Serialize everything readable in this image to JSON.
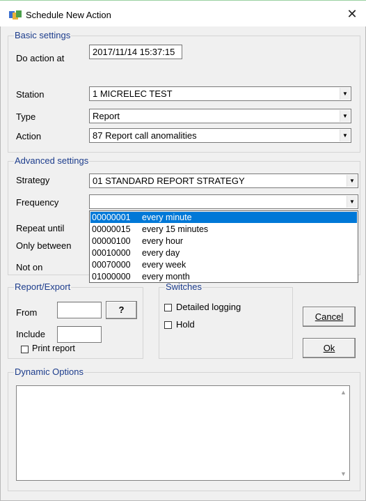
{
  "window": {
    "title": "Schedule New Action",
    "close_glyph": "✕"
  },
  "basic_settings": {
    "legend": "Basic settings",
    "do_action_at_label": "Do action at",
    "do_action_at_value": "2017/11/14 15:37:15",
    "station_label": "Station",
    "station_value": "1  MICRELEC TEST",
    "type_label": "Type",
    "type_value": "Report",
    "action_label": "Action",
    "action_value": "87  Report call anomalities"
  },
  "advanced_settings": {
    "legend": "Advanced settings",
    "strategy_label": "Strategy",
    "strategy_value": "01  STANDARD REPORT STRATEGY",
    "frequency_label": "Frequency",
    "frequency_value": "",
    "repeat_until_label": "Repeat until",
    "only_between_label": "Only between",
    "not_on_label": "Not on"
  },
  "frequency_dropdown": {
    "options": [
      {
        "code": "00000001",
        "label": "every minute",
        "selected": true
      },
      {
        "code": "00000015",
        "label": "every 15 minutes",
        "selected": false
      },
      {
        "code": "00000100",
        "label": "every hour",
        "selected": false
      },
      {
        "code": "00010000",
        "label": "every day",
        "selected": false
      },
      {
        "code": "00070000",
        "label": "every week",
        "selected": false
      },
      {
        "code": "01000000",
        "label": "every month",
        "selected": false
      }
    ]
  },
  "report_export": {
    "legend": "Report/Export",
    "from_label": "From",
    "from_value": "",
    "browse_label": "?",
    "include_label": "Include",
    "include_value": "",
    "print_report_label": "Print report",
    "print_report_checked": false
  },
  "switches": {
    "legend": "Switches",
    "detailed_logging_label": "Detailed logging",
    "detailed_logging_checked": false,
    "hold_label": "Hold",
    "hold_checked": false
  },
  "buttons": {
    "cancel_label": "Cancel",
    "ok_label": "Ok"
  },
  "dynamic_options": {
    "legend": "Dynamic Options",
    "value": ""
  },
  "colors": {
    "selection": "#0078d7",
    "group_label": "#1c3c8c"
  }
}
